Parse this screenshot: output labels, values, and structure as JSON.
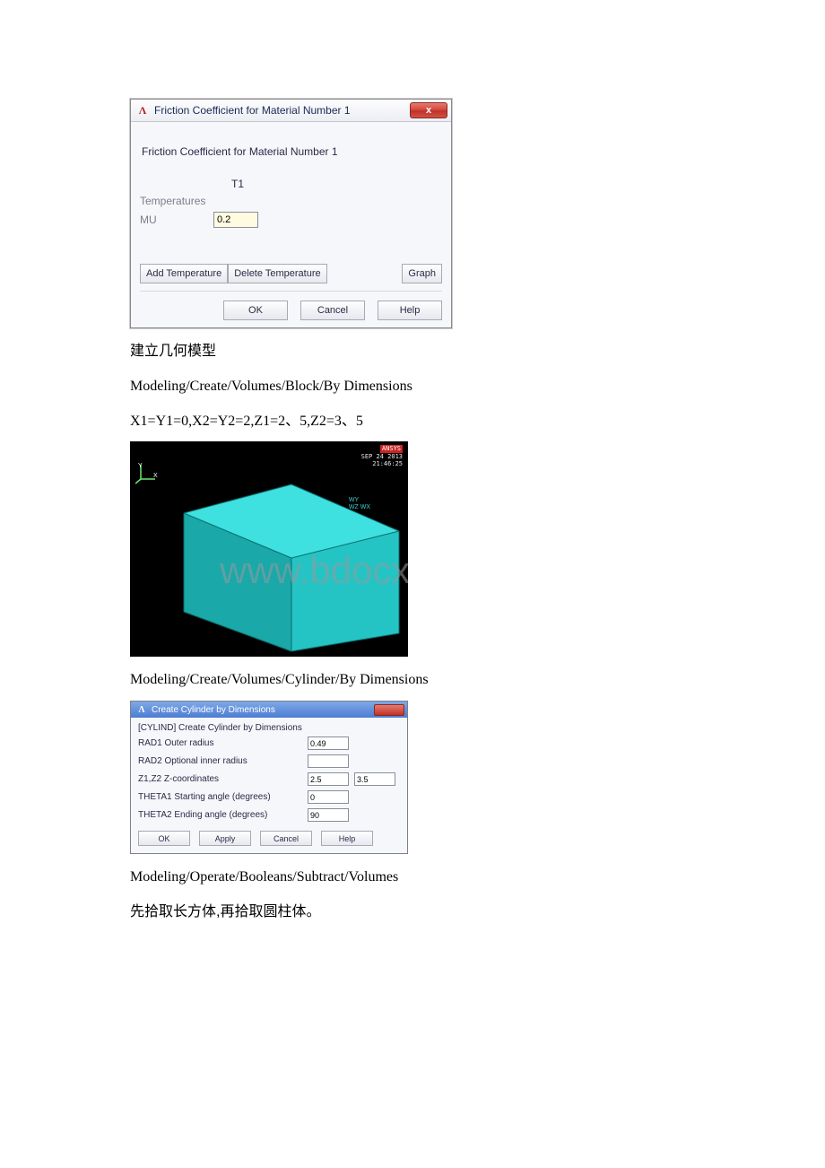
{
  "dialog1": {
    "title": "Friction Coefficient for Material Number 1",
    "close": "x",
    "mainLabel": "Friction Coefficient for Material Number 1",
    "colHeader": "T1",
    "tempLabel": "Temperatures",
    "muLabel": "MU",
    "muValue": "0.2",
    "addTemp": "Add Temperature",
    "delTemp": "Delete Temperature",
    "graph": "Graph",
    "ok": "OK",
    "cancel": "Cancel",
    "help": "Help"
  },
  "text1": "建立几何模型",
  "path1": "Modeling/Create/Volumes/Block/By Dimensions",
  "coords": "X1=Y1=0,X2=Y2=2,Z1=2、5,Z2=3、5",
  "viewport": {
    "stamp1": "ANSYS",
    "stamp2": "SEP 24 2013",
    "stamp3": "21:46:25",
    "mini1": "WY",
    "mini2": "WZ  WX"
  },
  "watermark": "www.bdocx.com",
  "path2": "Modeling/Create/Volumes/Cylinder/By Dimensions",
  "dialog2": {
    "title": "Create Cylinder by Dimensions",
    "header": "[CYLIND]  Create Cylinder by Dimensions",
    "rad1Label": "RAD1   Outer radius",
    "rad1Value": "0.49",
    "rad2Label": "RAD2    Optional inner radius",
    "rad2Value": "",
    "zLabel": "Z1,Z2   Z-coordinates",
    "z1Value": "2.5",
    "z2Value": "3.5",
    "th1Label": "THETA1  Starting angle (degrees)",
    "th1Value": "0",
    "th2Label": "THETA2  Ending angle (degrees)",
    "th2Value": "90",
    "ok": "OK",
    "apply": "Apply",
    "cancel": "Cancel",
    "help": "Help"
  },
  "path3": "Modeling/Operate/Booleans/Subtract/Volumes",
  "text2": "先拾取长方体,再拾取圆柱体。"
}
